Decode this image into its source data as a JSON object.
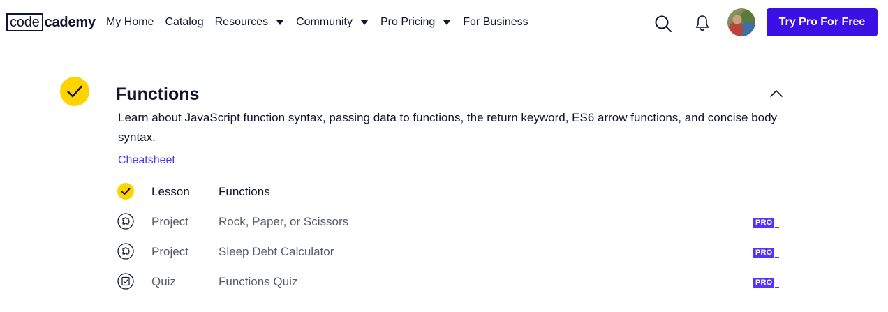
{
  "header": {
    "logo": {
      "code": "code",
      "cademy": "cademy"
    },
    "nav": [
      {
        "label": "My Home",
        "has_caret": false
      },
      {
        "label": "Catalog",
        "has_caret": false
      },
      {
        "label": "Resources",
        "has_caret": true
      },
      {
        "label": "Community",
        "has_caret": true
      },
      {
        "label": "Pro Pricing",
        "has_caret": true
      },
      {
        "label": "For Business",
        "has_caret": false
      }
    ],
    "search_icon": "search-icon",
    "notification_icon": "bell-icon",
    "cta_label": "Try Pro For Free"
  },
  "module": {
    "title": "Functions",
    "completed": true,
    "expanded": true,
    "description": "Learn about JavaScript function syntax, passing data to functions, the return keyword, ES6 arrow functions, and concise body syntax.",
    "cheatsheet_label": "Cheatsheet",
    "items": [
      {
        "type": "Lesson",
        "title": "Functions",
        "completed": true,
        "pro": false,
        "icon": "check-circle-icon"
      },
      {
        "type": "Project",
        "title": "Rock, Paper, or Scissors",
        "completed": false,
        "pro": true,
        "icon": "puzzle-icon"
      },
      {
        "type": "Project",
        "title": "Sleep Debt Calculator",
        "completed": false,
        "pro": true,
        "icon": "puzzle-icon"
      },
      {
        "type": "Quiz",
        "title": "Functions Quiz",
        "completed": false,
        "pro": true,
        "icon": "quiz-icon"
      }
    ],
    "pro_badge_label": "PRO"
  },
  "colors": {
    "brand_blue": "#3a10e5",
    "link_purple": "#5533ff",
    "complete_yellow": "#ffd300",
    "text_dark": "#10162f",
    "text_muted": "#585c6e"
  }
}
